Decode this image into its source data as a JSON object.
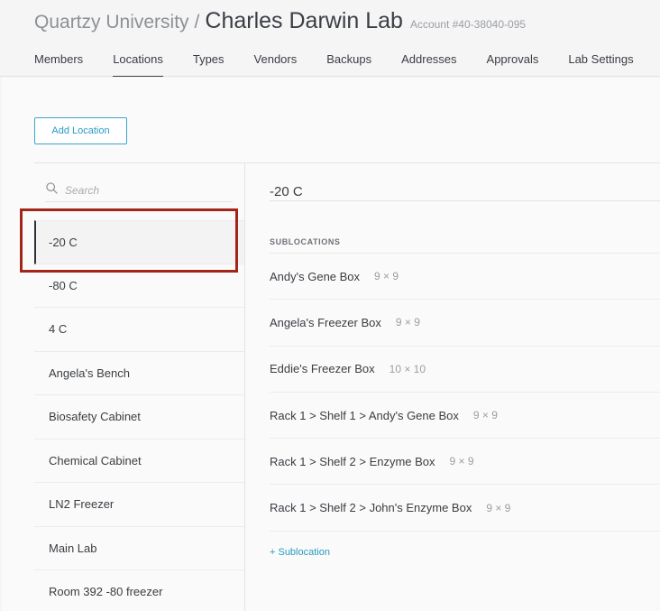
{
  "header": {
    "org": "Quartzy University",
    "separator": "/",
    "lab": "Charles Darwin Lab",
    "account": "Account #40-38040-095"
  },
  "tabs": [
    {
      "label": "Members"
    },
    {
      "label": "Locations",
      "active": true
    },
    {
      "label": "Types"
    },
    {
      "label": "Vendors"
    },
    {
      "label": "Backups"
    },
    {
      "label": "Addresses"
    },
    {
      "label": "Approvals"
    },
    {
      "label": "Lab Settings"
    }
  ],
  "toolbar": {
    "add_location_label": "Add Location"
  },
  "search": {
    "placeholder": "Search",
    "icon": "search-icon"
  },
  "locations": [
    {
      "label": "-20 C",
      "selected": true
    },
    {
      "label": "-80 C"
    },
    {
      "label": "4 C"
    },
    {
      "label": "Angela's Bench"
    },
    {
      "label": "Biosafety Cabinet"
    },
    {
      "label": "Chemical Cabinet"
    },
    {
      "label": "LN2 Freezer"
    },
    {
      "label": "Main Lab"
    },
    {
      "label": "Room 392 -80 freezer"
    }
  ],
  "detail": {
    "title": "-20 C",
    "sublocations_heading": "SUBLOCATIONS",
    "sublocations": [
      {
        "name": "Andy's Gene Box",
        "dims": "9 × 9"
      },
      {
        "name": "Angela's Freezer Box",
        "dims": "9 × 9"
      },
      {
        "name": "Eddie's Freezer Box",
        "dims": "10 × 10"
      },
      {
        "name": "Rack 1 > Shelf 1 > Andy's Gene Box",
        "dims": "9 × 9"
      },
      {
        "name": "Rack 1 > Shelf 2 > Enzyme Box",
        "dims": "9 × 9"
      },
      {
        "name": "Rack 1 > Shelf 2 > John's Enzyme Box",
        "dims": "9 × 9"
      }
    ],
    "add_sublocation_label": "+ Sublocation"
  },
  "colors": {
    "accent": "#2a9bc2",
    "highlight": "#a32419"
  }
}
